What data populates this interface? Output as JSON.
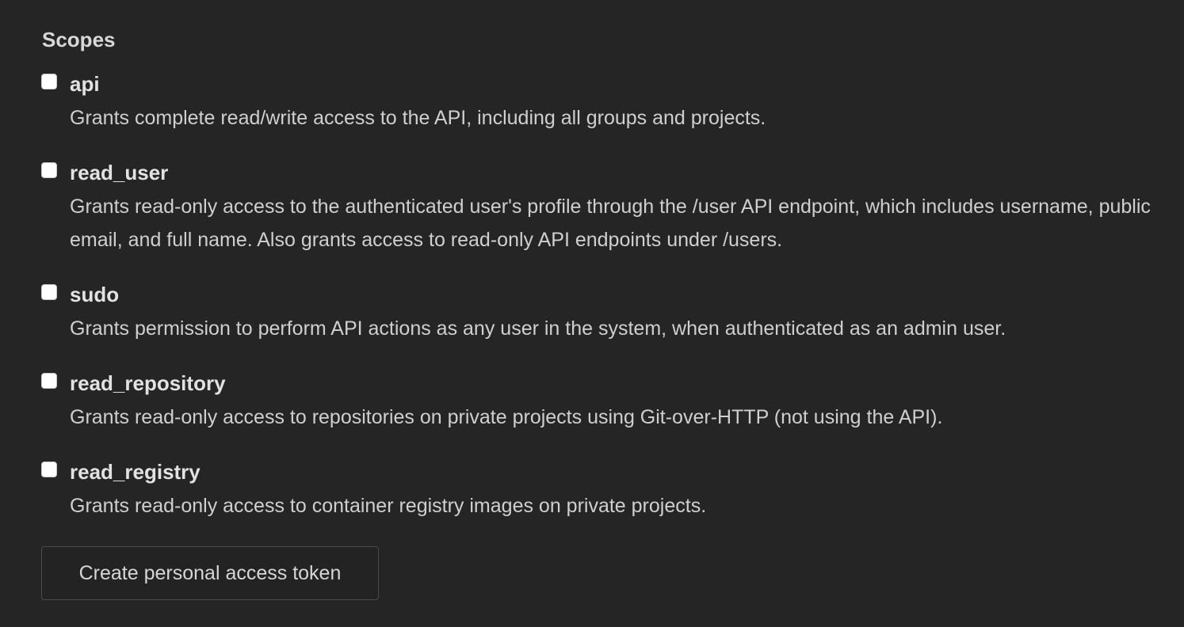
{
  "heading": "Scopes",
  "scopes": [
    {
      "name": "api",
      "checked": false,
      "description": "Grants complete read/write access to the API, including all groups and projects."
    },
    {
      "name": "read_user",
      "checked": false,
      "description": "Grants read-only access to the authenticated user's profile through the /user API endpoint, which includes username, public email, and full name. Also grants access to read-only API endpoints under /users."
    },
    {
      "name": "sudo",
      "checked": false,
      "description": "Grants permission to perform API actions as any user in the system, when authenticated as an admin user."
    },
    {
      "name": "read_repository",
      "checked": false,
      "description": "Grants read-only access to repositories on private projects using Git-over-HTTP (not using the API)."
    },
    {
      "name": "read_registry",
      "checked": false,
      "description": "Grants read-only access to container registry images on private projects."
    }
  ],
  "create_button_label": "Create personal access token",
  "colors": {
    "background": "#252526",
    "text": "#d6d6d6",
    "checkbox": "#ffffff",
    "button_border": "#4a4a4a"
  }
}
